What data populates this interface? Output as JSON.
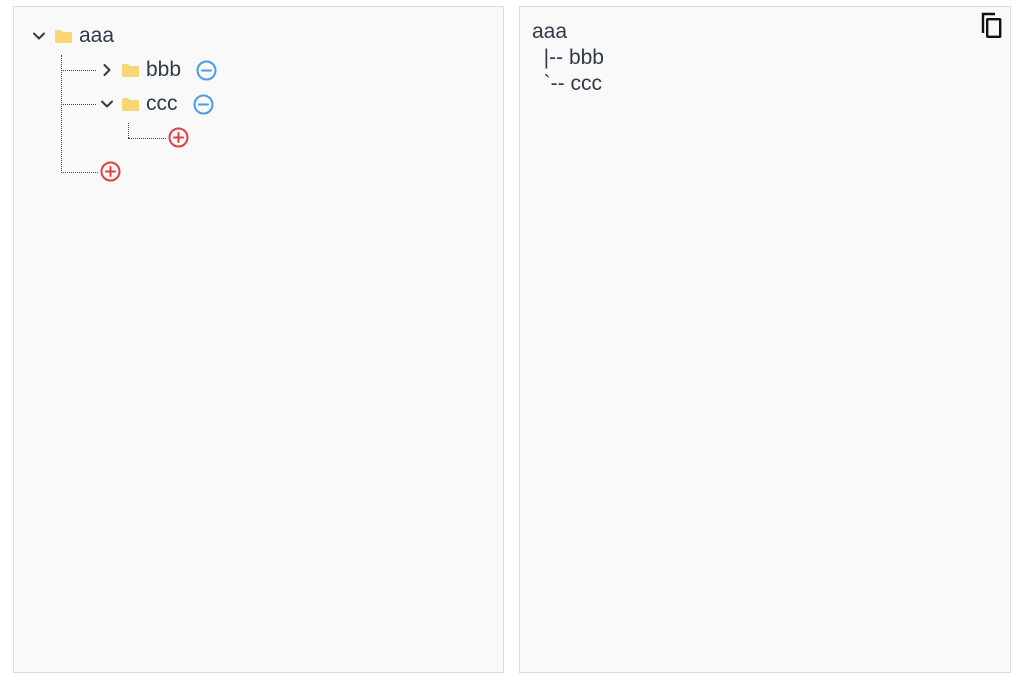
{
  "tree": {
    "root": {
      "label": "aaa",
      "expanded": true
    },
    "children": [
      {
        "label": "bbb",
        "expanded": false
      },
      {
        "label": "ccc",
        "expanded": true
      }
    ]
  },
  "output": {
    "lines": [
      "aaa",
      "  |-- bbb",
      "  `-- ccc"
    ]
  },
  "colors": {
    "folder": "#f7d774",
    "remove": "#4a9be8",
    "add": "#e04040",
    "text": "#2f3a4a"
  },
  "icons": [
    "chevron-down-icon",
    "chevron-right-icon",
    "folder-icon",
    "remove-icon",
    "add-icon",
    "copy-icon"
  ]
}
